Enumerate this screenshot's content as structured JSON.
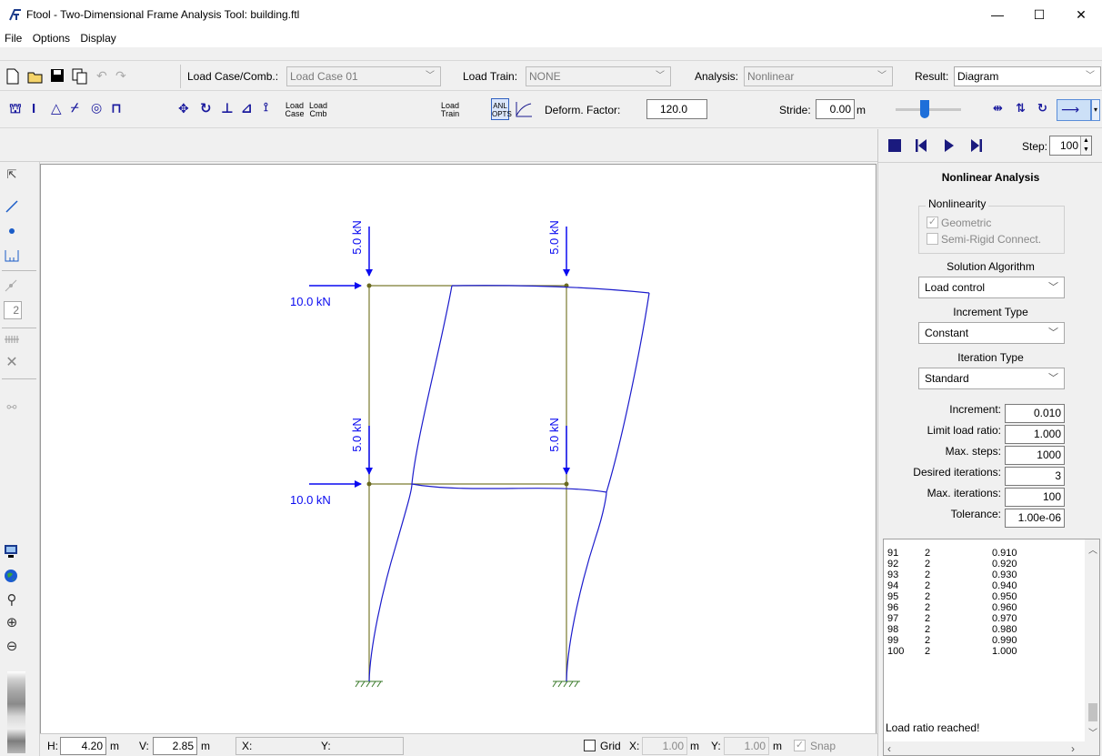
{
  "window": {
    "title": "Ftool - Two-Dimensional Frame Analysis Tool: building.ftl",
    "minimize": "—",
    "maximize": "☐",
    "close": "✕"
  },
  "menu": [
    "File",
    "Options",
    "Display"
  ],
  "toolbar1": {
    "load_case_label": "Load Case/Comb.:",
    "load_case_value": "Load Case 01",
    "load_train_label": "Load Train:",
    "load_train_value": "NONE",
    "analysis_label": "Analysis:",
    "analysis_value": "Nonlinear",
    "result_label": "Result:",
    "result_value": "Diagram"
  },
  "toolbar2": {
    "load_case_btn_1": "Load",
    "load_case_btn_2": "Case",
    "load_cmb_btn_1": "Load",
    "load_cmb_btn_2": "Cmb",
    "load_train_btn_1": "Load",
    "load_train_btn_2": "Train",
    "anl_opts_1": "ANL",
    "anl_opts_2": "OPTS",
    "deform_label": "Deform. Factor:",
    "deform_value": "120.0",
    "stride_label": "Stride:",
    "stride_value": "0.00",
    "stride_unit": "m"
  },
  "player": {
    "step_label": "Step:",
    "step_value": "100"
  },
  "canvas": {
    "loads": {
      "vertical_top_left": "5.0 kN",
      "vertical_top_right": "5.0 kN",
      "vertical_mid_left": "5.0 kN",
      "vertical_mid_right": "5.0 kN",
      "horizontal_top": "10.0 kN",
      "horizontal_mid": "10.0 kN"
    },
    "frame_color": "#7a7a30",
    "deformed_color": "#1c1ccc",
    "load_color": "#0a0af0"
  },
  "lefttoolbar": {
    "counter": "2"
  },
  "panel": {
    "title": "Nonlinear Analysis",
    "nonlinearity_label": "Nonlinearity",
    "geometric_label": "Geometric",
    "geometric_checked": "✓",
    "semirigid_label": "Semi-Rigid Connect.",
    "solution_label": "Solution Algorithm",
    "solution_value": "Load control",
    "increment_type_label": "Increment Type",
    "increment_type_value": "Constant",
    "iteration_type_label": "Iteration Type",
    "iteration_type_value": "Standard",
    "params": [
      {
        "label": "Increment:",
        "value": "0.010"
      },
      {
        "label": "Limit load ratio:",
        "value": "1.000"
      },
      {
        "label": "Max. steps:",
        "value": "1000"
      },
      {
        "label": "Desired iterations:",
        "value": "3"
      },
      {
        "label": "Max. iterations:",
        "value": "100"
      },
      {
        "label": "Tolerance:",
        "value": "1.00e-06"
      }
    ]
  },
  "log": {
    "rows": [
      [
        "91",
        "2",
        "0.910"
      ],
      [
        "92",
        "2",
        "0.920"
      ],
      [
        "93",
        "2",
        "0.930"
      ],
      [
        "94",
        "2",
        "0.940"
      ],
      [
        "95",
        "2",
        "0.950"
      ],
      [
        "96",
        "2",
        "0.960"
      ],
      [
        "97",
        "2",
        "0.970"
      ],
      [
        "98",
        "2",
        "0.980"
      ],
      [
        "99",
        "2",
        "0.990"
      ],
      [
        "100",
        "2",
        "1.000"
      ]
    ],
    "message": "Load ratio reached!"
  },
  "statusbar": {
    "h_label": "H:",
    "h_value": "4.20",
    "h_unit": "m",
    "v_label": "V:",
    "v_value": "2.85",
    "v_unit": "m",
    "x_label": "X:",
    "y_label": "Y:",
    "grid_label": "Grid",
    "gx_label": "X:",
    "gx_value": "1.00",
    "gx_unit": "m",
    "gy_label": "Y:",
    "gy_value": "1.00",
    "gy_unit": "m",
    "snap_label": "Snap"
  }
}
